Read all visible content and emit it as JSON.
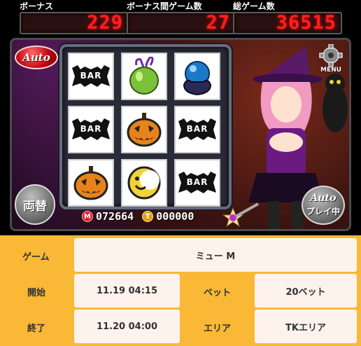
{
  "counters": {
    "bonus": {
      "label": "ボーナス",
      "value": "229"
    },
    "games_since_bonus": {
      "label": "ボーナス間ゲーム数",
      "value": "27"
    },
    "total_games": {
      "label": "総ゲーム数",
      "value": "36515"
    }
  },
  "buttons": {
    "auto": "Auto",
    "menu": "MENU",
    "exchange": "両替",
    "autoplay_line1": "Auto",
    "autoplay_line2": "プレイ中"
  },
  "reels": [
    [
      "bar",
      "green-apple",
      "crystal-ball"
    ],
    [
      "bar",
      "jack-o-lantern",
      "bar"
    ],
    [
      "jack-o-lantern",
      "moon",
      "bar"
    ]
  ],
  "reel_bar_text": "BAR",
  "credits": {
    "medal_icon": "M",
    "medal_value": "072664",
    "ticket_icon": "T",
    "ticket_value": "000000"
  },
  "info": {
    "game_label": "ゲーム",
    "game_value": "ミュー M",
    "start_label": "開始",
    "start_value": "11.19 04:15",
    "bet_label": "ベット",
    "bet_value": "20ベット",
    "end_label": "終了",
    "end_value": "11.20 04:00",
    "area_label": "エリア",
    "area_value": "TKエリア"
  },
  "colors": {
    "led_red": "#ff2020",
    "panel_orange": "#f9b836",
    "cell_bg": "#fdf3ec"
  }
}
